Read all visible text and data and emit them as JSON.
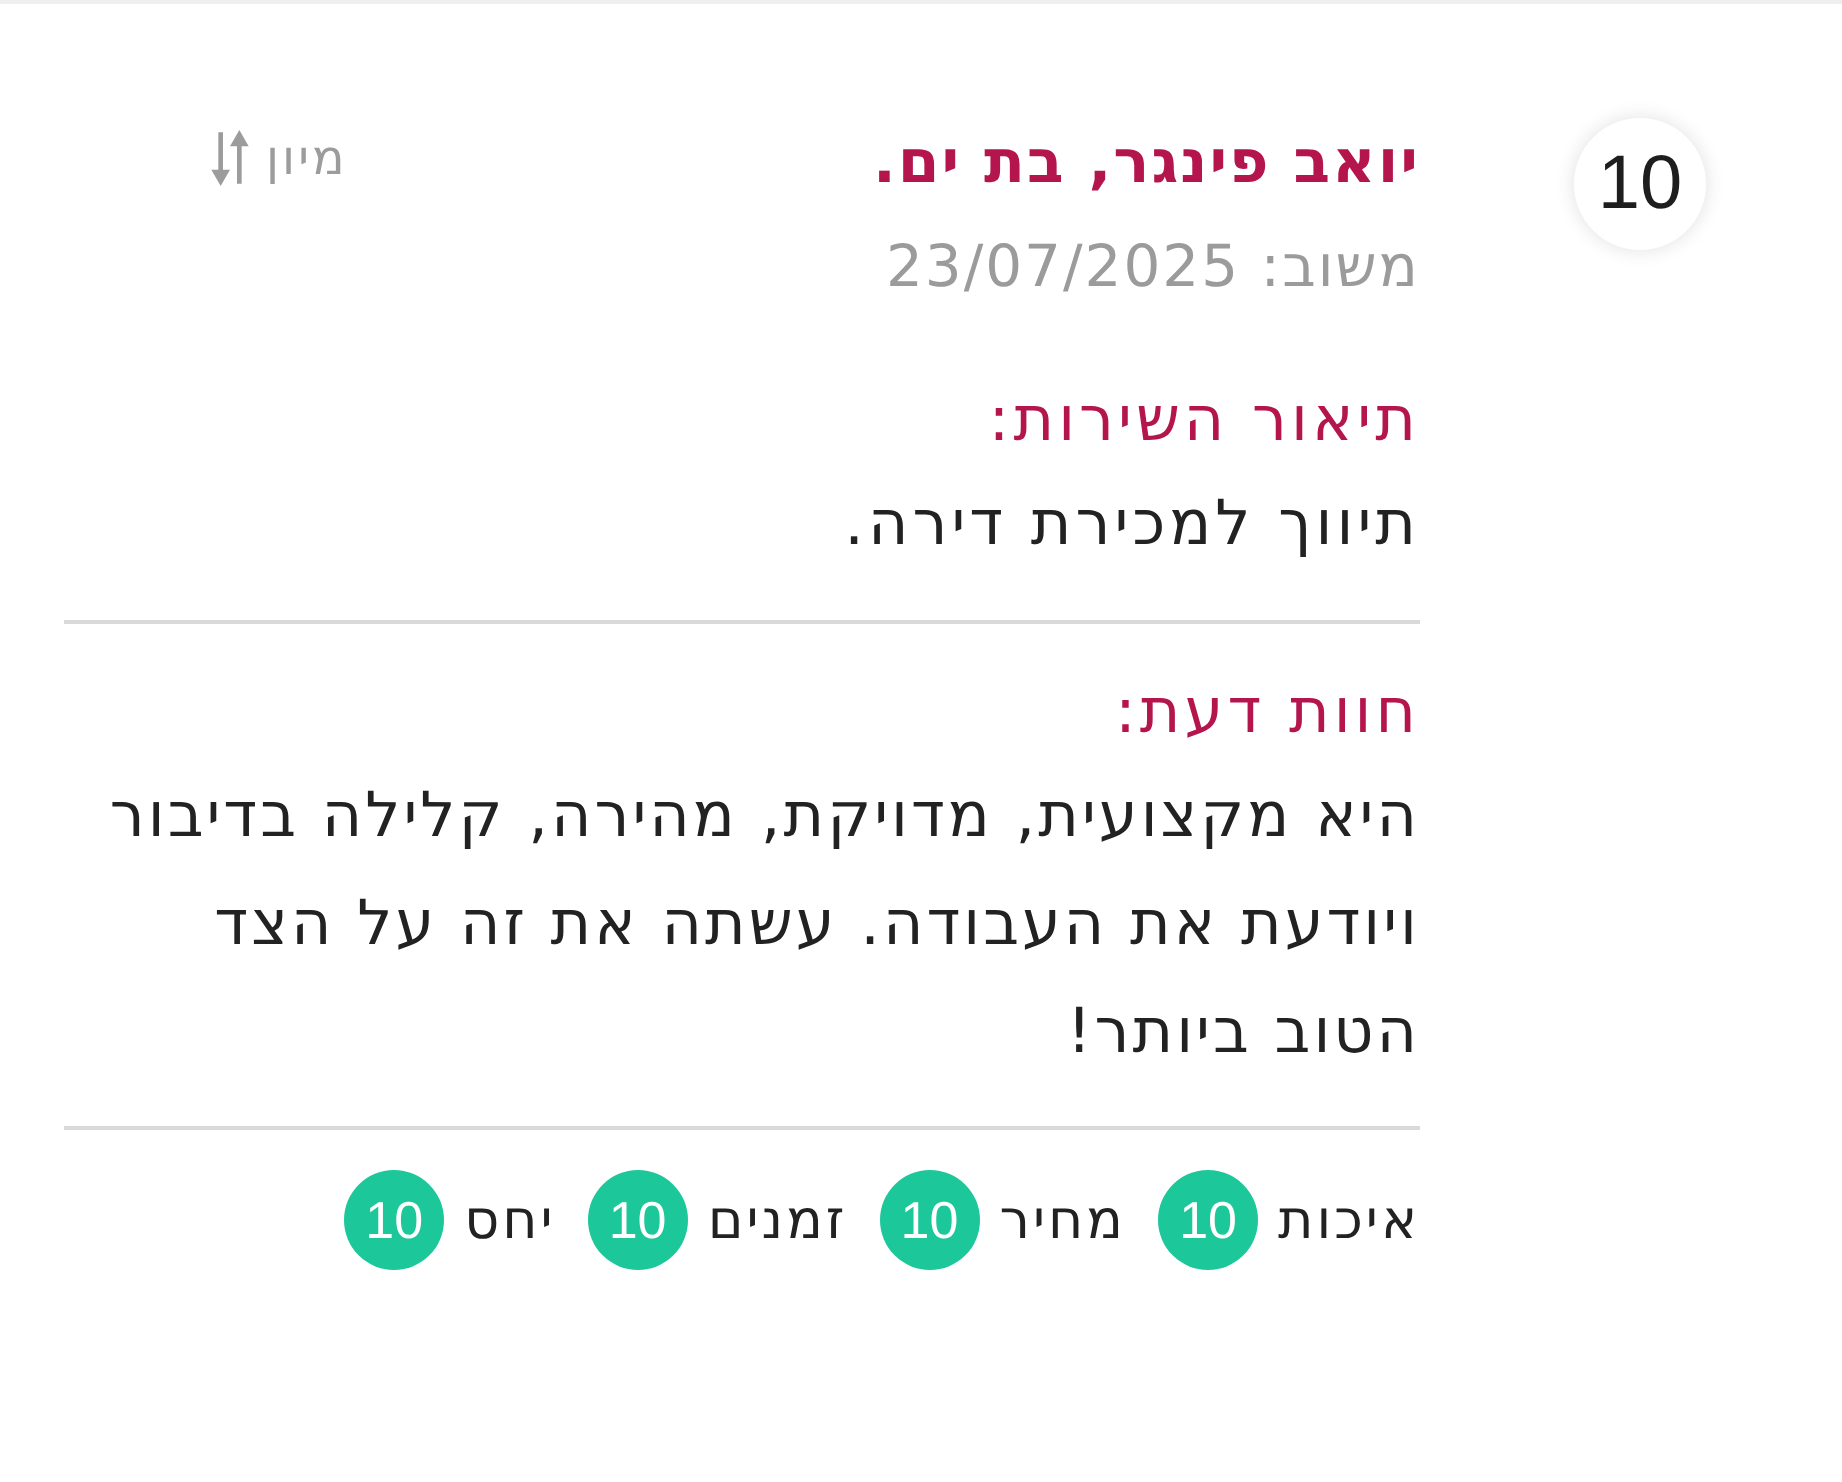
{
  "score": "10",
  "reviewer": {
    "name": "יואב פינגר, בת ים.",
    "date": "משוב: 23/07/2025"
  },
  "sort": {
    "label": "מיון"
  },
  "service": {
    "heading": "תיאור השירות:",
    "text": "תיווך למכירת דירה."
  },
  "opinion": {
    "heading": "חוות דעת:",
    "text": "היא מקצועית, מדויקת, מהירה, קלילה בדיבור ויודעת את העבודה. עשתה את זה על הצד הטוב ביותר!"
  },
  "ratings": [
    {
      "label": "איכות",
      "score": "10"
    },
    {
      "label": "מחיר",
      "score": "10"
    },
    {
      "label": "זמנים",
      "score": "10"
    },
    {
      "label": "יחס",
      "score": "10"
    }
  ]
}
